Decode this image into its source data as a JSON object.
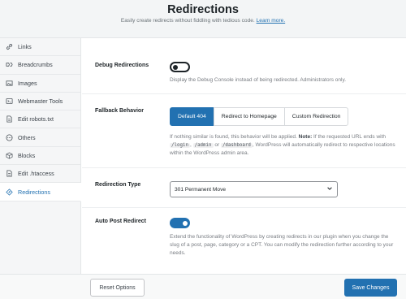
{
  "header": {
    "title": "Redirections",
    "subtitle": "Easily create redirects without fiddling with tedious code.",
    "learn_more": "Learn more."
  },
  "sidebar": {
    "items": [
      {
        "label": "Links",
        "icon": "link-icon",
        "active": false
      },
      {
        "label": "Breadcrumbs",
        "icon": "breadcrumb-icon",
        "active": false
      },
      {
        "label": "Images",
        "icon": "image-icon",
        "active": false
      },
      {
        "label": "Webmaster Tools",
        "icon": "webmaster-icon",
        "active": false
      },
      {
        "label": "Edit robots.txt",
        "icon": "document-icon",
        "active": false
      },
      {
        "label": "Others",
        "icon": "others-icon",
        "active": false
      },
      {
        "label": "Blocks",
        "icon": "blocks-icon",
        "active": false
      },
      {
        "label": "Edit .htaccess",
        "icon": "document-icon",
        "active": false
      },
      {
        "label": "Redirections",
        "icon": "redirect-icon",
        "active": true
      }
    ]
  },
  "settings": {
    "debug": {
      "label": "Debug Redirections",
      "enabled": false,
      "description": "Display the Debug Console instead of being redirected. Administrators only."
    },
    "fallback": {
      "label": "Fallback Behavior",
      "options": [
        "Default 404",
        "Redirect to Homepage",
        "Custom Redirection"
      ],
      "selected": "Default 404",
      "desc_part1": "If nothing similar is found, this behavior will be applied.",
      "note_label": "Note:",
      "desc_part2": "If the requested URL ends with",
      "code1": "/login",
      "code2": "/admin",
      "desc_or": "or",
      "code3": "/dashboard",
      "desc_part3": "WordPress will automatically redirect to respective locations within the WordPress admin area."
    },
    "redirection_type": {
      "label": "Redirection Type",
      "value": "301 Permanent Move"
    },
    "auto_post": {
      "label": "Auto Post Redirect",
      "enabled": true,
      "description": "Extend the functionality of WordPress by creating redirects in our plugin when you change the slug of a post, page, category or a CPT. You can modify the redirection further according to your needs."
    }
  },
  "footer": {
    "reset_label": "Reset Options",
    "save_label": "Save Changes"
  },
  "colors": {
    "accent": "#2271b1",
    "text": "#1d2327",
    "muted": "#787c82"
  }
}
